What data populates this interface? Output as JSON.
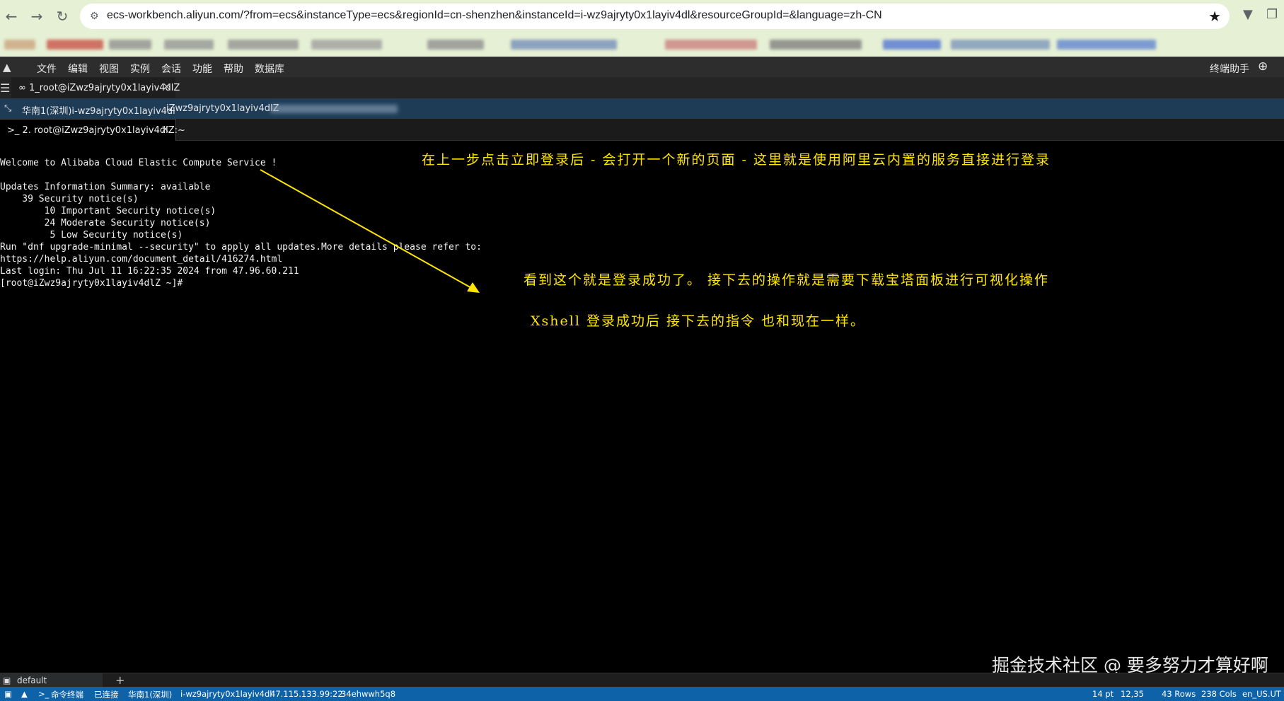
{
  "browser": {
    "url": "ecs-workbench.aliyun.com/?from=ecs&instanceType=ecs&regionId=cn-shenzhen&instanceId=i-wz9ajryty0x1layiv4dl&resourceGroupId=&language=zh-CN"
  },
  "menubar": {
    "items": [
      "文件",
      "编辑",
      "视图",
      "实例",
      "会话",
      "功能",
      "帮助",
      "数据库"
    ],
    "right_label": "终端助手"
  },
  "session_tab": {
    "label": "1_root@iZwz9ajryty0x1layiv4dlZ"
  },
  "infobar": {
    "region": "华南1(深圳)i-wz9ajryty0x1layiv4dl",
    "hostname": "iZwz9ajryty0x1layiv4dlZ"
  },
  "terminal_tab": {
    "label": "2. root@iZwz9ajryty0x1layiv4dlZ:~"
  },
  "terminal": {
    "lines": [
      "Welcome to Alibaba Cloud Elastic Compute Service !",
      "",
      "Updates Information Summary: available",
      "    39 Security notice(s)",
      "        10 Important Security notice(s)",
      "        24 Moderate Security notice(s)",
      "         5 Low Security notice(s)",
      "Run \"dnf upgrade-minimal --security\" to apply all updates.More details please refer to:",
      "https://help.aliyun.com/document_detail/416274.html",
      "Last login: Thu Jul 11 16:22:35 2024 from 47.96.60.211",
      "[root@iZwz9ajryty0x1layiv4dlZ ~]#"
    ]
  },
  "annotations": {
    "note1": "在上一步点击立即登录后 - 会打开一个新的页面 -  这里就是使用阿里云内置的服务直接进行登录",
    "note2": "看到这个就是登录成功了。 接下去的操作就是需要下载宝塔面板进行可视化操作",
    "note3": "Xshell 登录成功后 接下去的指令 也和现在一样。",
    "color": "#ffe600"
  },
  "watermark": "掘金技术社区 @ 要多努力才算好啊",
  "panel": {
    "tab": "default"
  },
  "statusbar": {
    "terminal_label": "命令终端",
    "connection": "已连接",
    "region": "华南1(深圳)",
    "instance": "i-wz9ajryty0x1layiv4dl",
    "ip": "47.115.133.99:22",
    "session": "34ehwwh5q8",
    "font_size": "14 pt",
    "cursor": "12,35",
    "rows": "43 Rows",
    "cols": "238 Cols",
    "locale": "en_US.UT"
  }
}
